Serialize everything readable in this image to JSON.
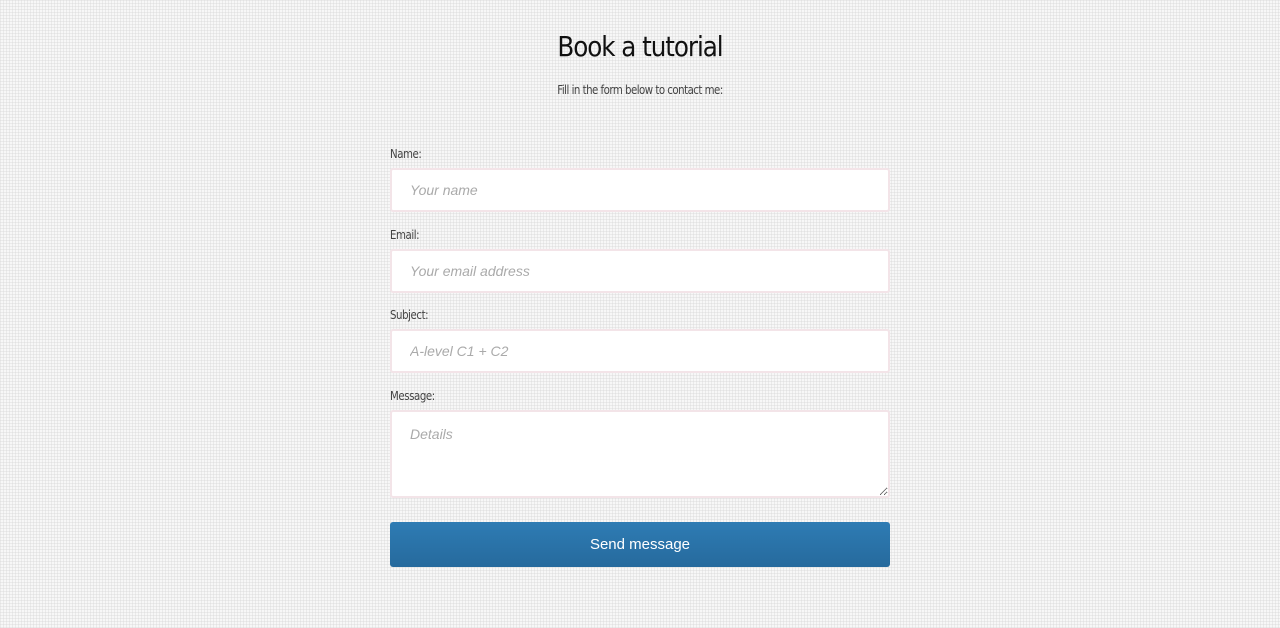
{
  "header": {
    "title": "Book a tutorial",
    "subtitle": "Fill in the form below to contact me:"
  },
  "form": {
    "name": {
      "label": "Name:",
      "placeholder": "Your name"
    },
    "email": {
      "label": "Email:",
      "placeholder": "Your email address"
    },
    "subject": {
      "label": "Subject:",
      "placeholder": "A-level C1 + C2"
    },
    "message": {
      "label": "Message:",
      "placeholder": "Details"
    },
    "submit_label": "Send message"
  },
  "colors": {
    "button": "#2a74aa",
    "field_border": "#f3e4e8",
    "background": "#f7f7f7"
  }
}
